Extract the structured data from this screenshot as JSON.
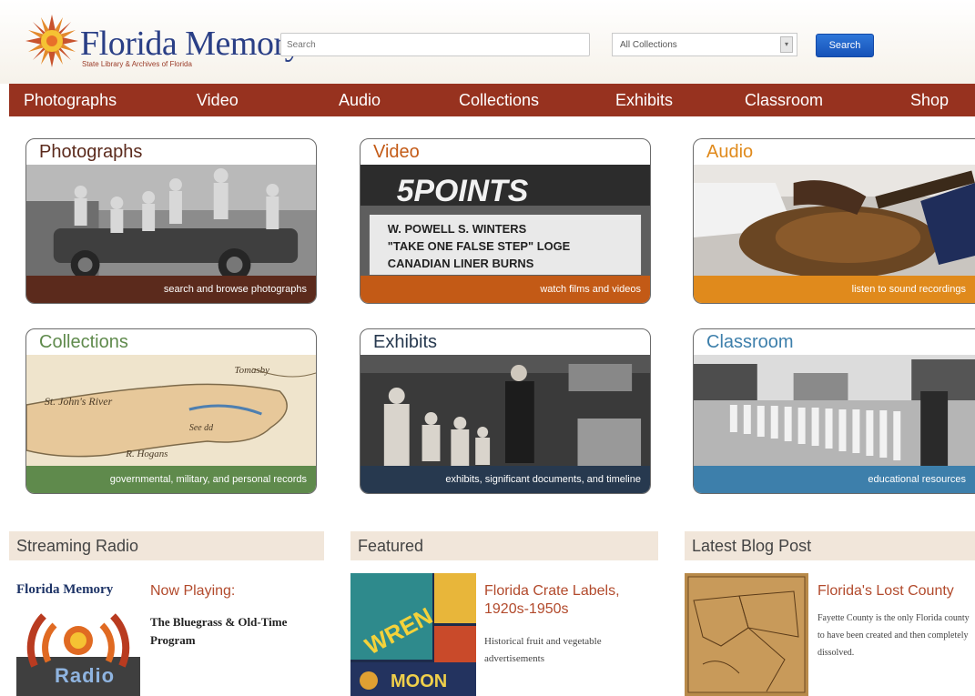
{
  "header": {
    "logo_title": "Florida Memory",
    "logo_subtitle": "State Library & Archives of Florida",
    "search_placeholder": "Search",
    "collection_select": "All Collections",
    "search_button": "Search"
  },
  "nav": [
    "Photographs",
    "Video",
    "Audio",
    "Collections",
    "Exhibits",
    "Classroom",
    "Shop"
  ],
  "tiles": [
    {
      "title": "Photographs",
      "caption": "search and browse photographs",
      "color": "#5b2a1c"
    },
    {
      "title": "Video",
      "caption": "watch films and videos",
      "color": "#c35a16"
    },
    {
      "title": "Audio",
      "caption": "listen to sound recordings",
      "color": "#e08a1c"
    },
    {
      "title": "Collections",
      "caption": "governmental, military, and personal records",
      "color": "#5f8a4c"
    },
    {
      "title": "Exhibits",
      "caption": "exhibits, significant documents, and timeline",
      "color": "#27394f"
    },
    {
      "title": "Classroom",
      "caption": "educational resources",
      "color": "#3d7fab"
    }
  ],
  "radio": {
    "heading": "Streaming Radio",
    "logo_title": "Florida Memory",
    "logo_word": "Radio",
    "now_playing": "Now Playing:",
    "program": "The Bluegrass & Old-Time Program"
  },
  "featured": {
    "heading": "Featured",
    "title": "Florida Crate Labels, 1920s-1950s",
    "description": "Historical fruit and vegetable advertisements",
    "label_words": [
      "WREN",
      "MOON"
    ]
  },
  "blog": {
    "heading": "Latest Blog Post",
    "title": "Florida's Lost County",
    "excerpt": "Fayette County is the only Florida county to have been created and then completely dissolved."
  },
  "colors": {
    "nav": "#97321f",
    "logo_blue": "#2a3f86",
    "accent_title": "#b24a2c"
  }
}
